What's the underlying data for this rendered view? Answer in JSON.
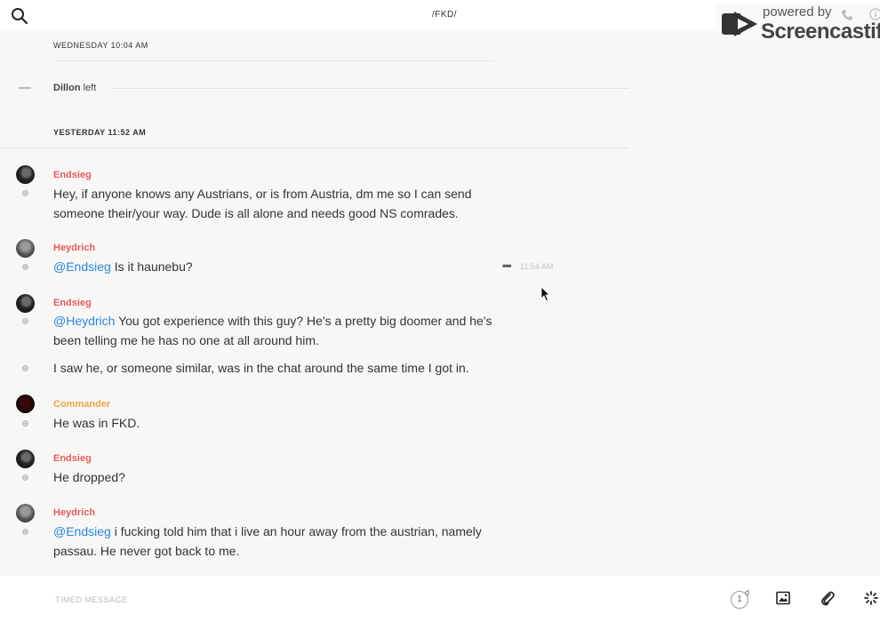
{
  "header": {
    "title": "/FKD/",
    "search_icon": "search-icon",
    "watermark_top": "powered by",
    "watermark_brand": "Screencastify"
  },
  "days": {
    "first": "WEDNESDAY 10:04 AM",
    "second": "YESTERDAY 11:52 AM"
  },
  "system_event": {
    "name": "Dillon",
    "action": "left"
  },
  "messages": [
    {
      "author": "Endsieg",
      "text": "Hey, if anyone knows any Austrians, or is from Austria, dm me so I can send someone their/your way. Dude is all alone and needs good NS comrades."
    },
    {
      "author": "Heydrich",
      "mention": "@Endsieg",
      "text": " Is it haunebu?",
      "time": "11:54 AM"
    },
    {
      "author": "Endsieg",
      "mention": "@Heydrich",
      "text": " You got experience with this guy? He's a pretty big doomer and he's been telling me he has no one at all around him.",
      "followup": "I saw he, or someone similar, was in the chat around the same time I got in."
    },
    {
      "author": "Commander",
      "text": "He was in FKD."
    },
    {
      "author": "Endsieg",
      "text": "He dropped?"
    },
    {
      "author": "Heydrich",
      "mention": "@Endsieg",
      "text": " i fucking told him that i live an hour away from the austrian, namely passau. He never got back to me."
    }
  ],
  "composer": {
    "placeholder": "TIMED MESSAGE",
    "timer_value": "1",
    "timer_unit": "d"
  },
  "colors": {
    "author_red": "#e35d5d",
    "author_orange": "#f0a34f",
    "mention_blue": "#2a86d9"
  }
}
